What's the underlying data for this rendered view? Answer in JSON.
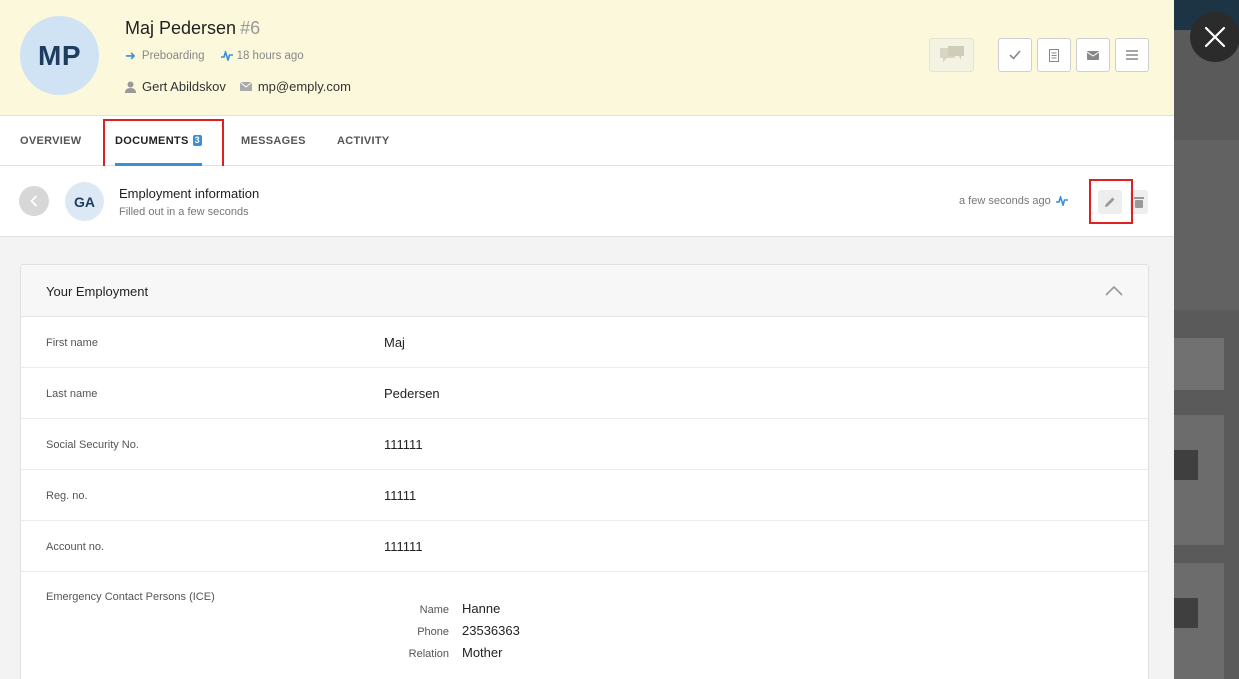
{
  "candidate": {
    "initials": "MP",
    "name": "Maj Pedersen",
    "number": "#6",
    "stage": "Preboarding",
    "last_activity": "18 hours ago",
    "owner": "Gert Abildskov",
    "email": "mp@emply.com"
  },
  "tabs": [
    {
      "label": "OVERVIEW"
    },
    {
      "label": "DOCUMENTS",
      "badge": "3"
    },
    {
      "label": "MESSAGES"
    },
    {
      "label": "ACTIVITY"
    }
  ],
  "document": {
    "initials": "GA",
    "title": "Employment information",
    "subtitle": "Filled out in a few seconds",
    "time": "a few seconds ago"
  },
  "section": {
    "title": "Your Employment",
    "fields": [
      {
        "label": "First name",
        "value": "Maj"
      },
      {
        "label": "Last name",
        "value": "Pedersen"
      },
      {
        "label": "Social Security No.",
        "value": "111111"
      },
      {
        "label": "Reg. no.",
        "value": "11111"
      },
      {
        "label": "Account no.",
        "value": "111111"
      }
    ],
    "emergency": {
      "label": "Emergency Contact Persons (ICE)",
      "entries": [
        {
          "label": "Name",
          "value": "Hanne"
        },
        {
          "label": "Phone",
          "value": "23536363"
        },
        {
          "label": "Relation",
          "value": "Mother"
        }
      ]
    }
  },
  "colors": {
    "accent": "#3a8fd6",
    "header_bg": "#fbf8dc",
    "highlight": "#e02020"
  },
  "icons": [
    "stage-arrow-icon",
    "activity-pulse-icon",
    "user-icon",
    "mail-icon",
    "chat-icon",
    "check-icon",
    "document-icon",
    "envelope-icon",
    "menu-icon",
    "back-icon",
    "pencil-icon",
    "trash-icon",
    "chevron-up-icon",
    "close-icon"
  ]
}
